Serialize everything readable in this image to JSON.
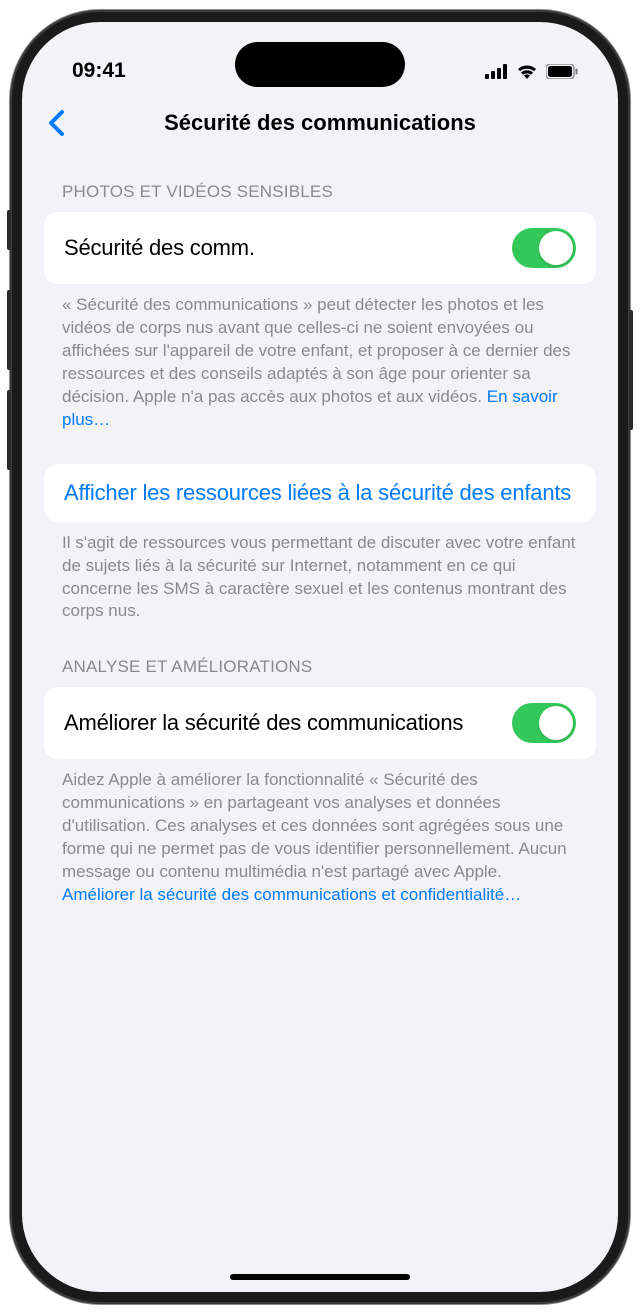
{
  "status_bar": {
    "time": "09:41"
  },
  "nav": {
    "title": "Sécurité des communications"
  },
  "sections": {
    "sensitive": {
      "header": "PHOTOS ET VIDÉOS SENSIBLES",
      "toggle_label": "Sécurité des comm.",
      "footer_text": "« Sécurité des communications » peut détecter les photos et les vidéos de corps nus avant que celles-ci ne soient envoyées ou affichées sur l'appareil de votre enfant, et proposer à ce dernier des ressources et des conseils adaptés à son âge pour orienter sa décision. Apple n'a pas accès aux photos et aux vidéos. ",
      "footer_link": "En savoir plus…"
    },
    "resources": {
      "link_label": "Afficher les ressources liées à la sécurité des enfants",
      "footer_text": "Il s'agit de ressources vous permettant de discuter avec votre enfant de sujets liés à la sécurité sur Internet, notamment en ce qui concerne les SMS à caractère sexuel et les contenus montrant des corps nus."
    },
    "analytics": {
      "header": "ANALYSE ET AMÉLIORATIONS",
      "toggle_label": "Améliorer la sécurité des communications",
      "footer_text": "Aidez Apple à améliorer la fonctionnalité « Sécurité des communications » en partageant vos analyses et données d'utilisation. Ces analyses et ces données sont agrégées sous une forme qui ne permet pas de vous identifier personnellement. Aucun message ou contenu multimédia n'est partagé avec Apple. ",
      "footer_link": "Améliorer la sécurité des communications et confidentialité…"
    }
  }
}
